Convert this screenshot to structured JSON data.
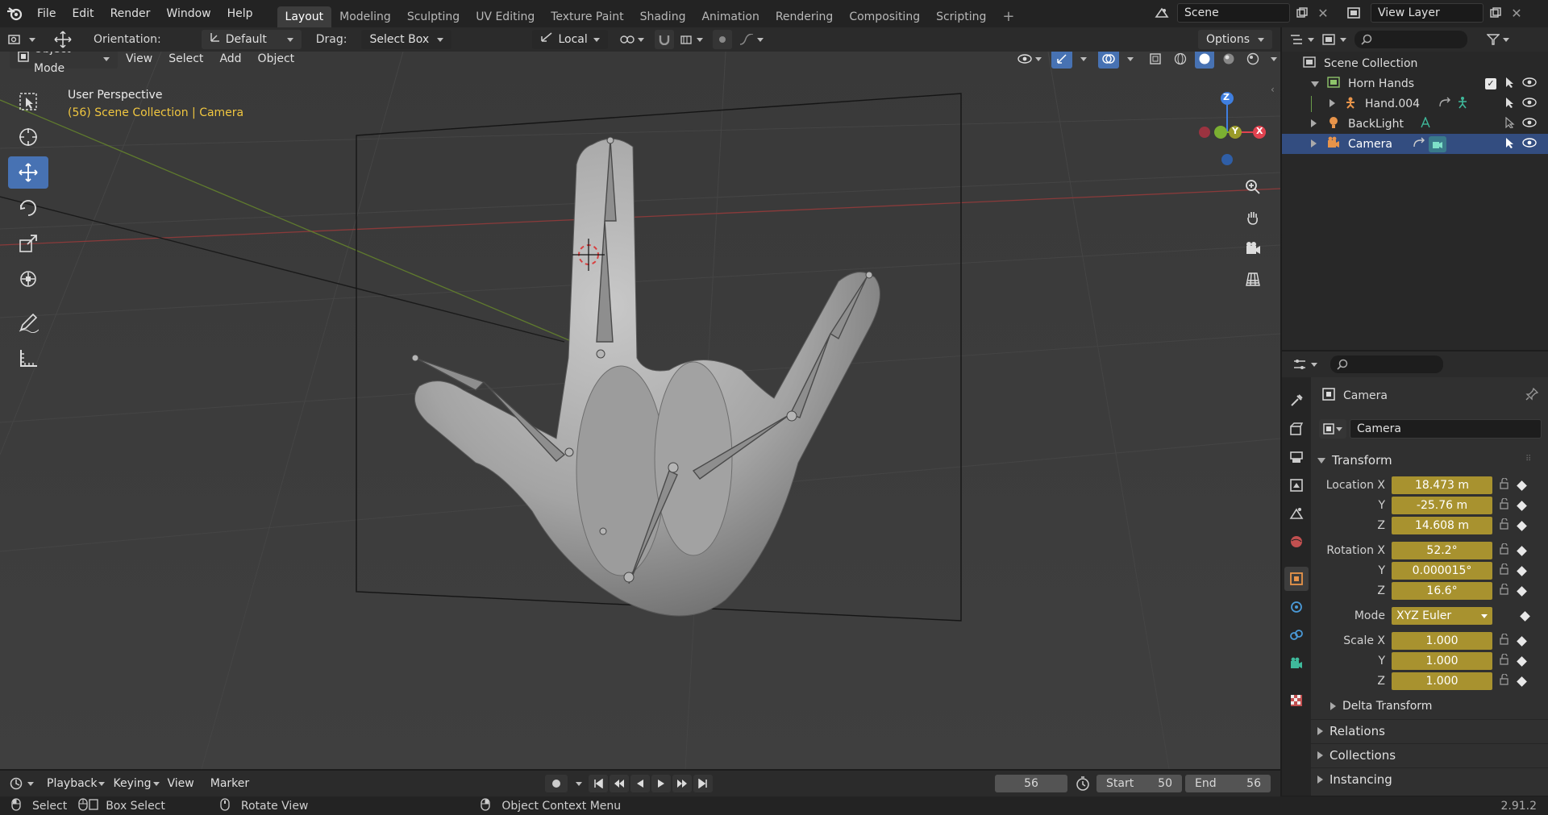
{
  "topbar": {
    "menus": [
      "File",
      "Edit",
      "Render",
      "Window",
      "Help"
    ],
    "workspaces": [
      "Layout",
      "Modeling",
      "Sculpting",
      "UV Editing",
      "Texture Paint",
      "Shading",
      "Animation",
      "Rendering",
      "Compositing",
      "Scripting"
    ],
    "active_workspace": "Layout",
    "add_tab": "+",
    "scene_name": "Scene",
    "view_layer_name": "View Layer"
  },
  "viewport_header": {
    "orientation_label": "Orientation:",
    "orientation_value": "Default",
    "drag_label": "Drag:",
    "drag_value": "Select Box",
    "pivot_value": "Local",
    "options_label": "Options",
    "mode_value": "Object Mode",
    "menus": [
      "View",
      "Select",
      "Add",
      "Object"
    ]
  },
  "viewport": {
    "perspective_label": "User Perspective",
    "collection_label": "(56) Scene Collection | Camera",
    "gizmo": {
      "x": "X",
      "y": "Y",
      "z": "Z"
    }
  },
  "outliner": {
    "root": "Scene Collection",
    "items": [
      {
        "label": "Horn Hands"
      },
      {
        "label": "Hand.004"
      },
      {
        "label": "BackLight"
      },
      {
        "label": "Camera"
      }
    ]
  },
  "properties": {
    "object_name": "Camera",
    "data_name": "Camera",
    "transform_header": "Transform",
    "location": [
      {
        "label": "Location X",
        "value": "18.473 m"
      },
      {
        "label": "Y",
        "value": "-25.76 m"
      },
      {
        "label": "Z",
        "value": "14.608 m"
      }
    ],
    "rotation": [
      {
        "label": "Rotation X",
        "value": "52.2°"
      },
      {
        "label": "Y",
        "value": "0.000015°"
      },
      {
        "label": "Z",
        "value": "16.6°"
      }
    ],
    "mode": {
      "label": "Mode",
      "value": "XYZ Euler"
    },
    "scale": [
      {
        "label": "Scale X",
        "value": "1.000"
      },
      {
        "label": "Y",
        "value": "1.000"
      },
      {
        "label": "Z",
        "value": "1.000"
      }
    ],
    "delta_transform": "Delta Transform",
    "sections": [
      "Relations",
      "Collections",
      "Instancing"
    ]
  },
  "timeline": {
    "menus": [
      "Playback",
      "Keying",
      "View",
      "Marker"
    ],
    "current_frame": "56",
    "start_label": "Start",
    "start_value": "50",
    "end_label": "End",
    "end_value": "56"
  },
  "statusbar": {
    "select": "Select",
    "box_select": "Box Select",
    "rotate_view": "Rotate View",
    "context_menu": "Object Context Menu",
    "version": "2.91.2"
  },
  "colors": {
    "accent_blue": "#4772b3",
    "selection": "#334d80",
    "animated_field": "#a8922f",
    "axis_x": "#e0424f",
    "axis_y": "#7bb032",
    "axis_z": "#3f7fe0"
  }
}
